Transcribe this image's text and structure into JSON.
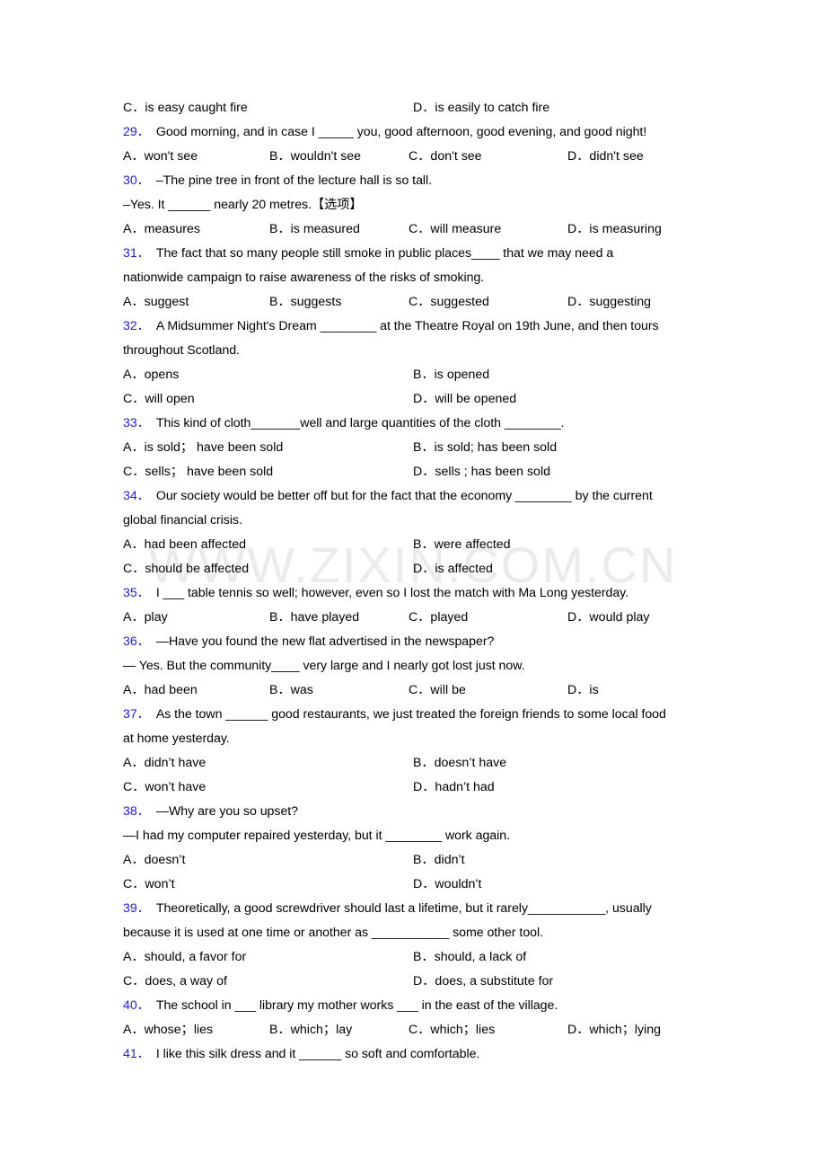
{
  "page": {
    "watermark": "WWW.ZIXIN.COM.CN",
    "accent_blue": "#2222cc",
    "background": "#ffffff",
    "text_color": "#000000"
  },
  "lines": {
    "prev_q_opt_c": "C．is easy caught fire",
    "prev_q_opt_d": "D．is easily to catch fire"
  },
  "questions": [
    {
      "number": "29．",
      "stem": "Good morning, and in case I _____ you, good afternoon, good evening, and good night!",
      "layout": "four",
      "options": [
        "A．won't see",
        "B．wouldn't see",
        "C．don't see",
        "D．didn't see"
      ]
    },
    {
      "number": "30．",
      "stem": "–The pine tree in front of the lecture hall is so tall.",
      "stem2": "–Yes. It ______ nearly 20 metres.【选项】",
      "layout": "four",
      "options": [
        "A．measures",
        "B．is measured",
        "C．will measure",
        "D．is measuring"
      ]
    },
    {
      "number": "31．",
      "stem": "The fact that so many people still smoke in public places____ that we may need a",
      "stem2": "nationwide campaign to raise awareness of the risks of smoking.",
      "layout": "four",
      "options": [
        "A．suggest",
        "B．suggests",
        "C．suggested",
        "D．suggesting"
      ]
    },
    {
      "number": "32．",
      "stem": "A Midsummer Night's Dream ________ at the Theatre Royal on 19th June, and then tours",
      "stem2": "throughout Scotland.",
      "layout": "two",
      "options": [
        "A．opens",
        "B．is opened",
        "C．will open",
        "D．will be opened"
      ]
    },
    {
      "number": "33．",
      "stem": "This kind of cloth_______well and large quantities of the cloth ________.",
      "layout": "two",
      "options": [
        "A．is sold；  have been sold",
        "B．is sold; has been sold",
        "C．sells；  have been sold",
        "D．sells ; has been sold"
      ]
    },
    {
      "number": "34．",
      "stem": "Our society would be better off but for the fact that the economy ________ by the current",
      "stem2": "global financial crisis.",
      "layout": "two",
      "options": [
        "A．had been affected",
        "B．were affected",
        "C．should be affected",
        "D．is affected"
      ]
    },
    {
      "number": "35．",
      "stem": "I ___ table tennis so well; however, even so I lost the match with Ma Long yesterday.",
      "layout": "four",
      "options": [
        "A．play",
        "B．have played",
        "C．played",
        "D．would play"
      ]
    },
    {
      "number": "36．",
      "stem": "—Have you found the new flat advertised in the newspaper?",
      "stem2": "— Yes. But the community____ very large and I nearly got lost just now.",
      "layout": "four",
      "options": [
        "A．had been",
        "B．was",
        "C．will be",
        "D．is"
      ]
    },
    {
      "number": "37．",
      "stem": "As the town ______ good restaurants, we just treated the foreign friends to some local food",
      "stem2": "at home yesterday.",
      "layout": "two",
      "options": [
        "A．didn’t have",
        "B．doesn’t have",
        "C．won’t have",
        "D．hadn’t had"
      ]
    },
    {
      "number": "38．",
      "stem": "—Why are you so upset?",
      "stem2": "—I had my computer repaired yesterday, but it ________ work again.",
      "layout": "two",
      "options": [
        "A．doesn’t",
        "B．didn’t",
        "C．won’t",
        "D．wouldn’t"
      ]
    },
    {
      "number": "39．",
      "stem": "Theoretically, a good screwdriver should last a lifetime, but it rarely___________, usually",
      "stem2": "because it is used at one time or another as ___________ some other tool.",
      "layout": "two",
      "options": [
        "A．should, a favor for",
        "B．should, a lack of",
        "C．does, a way of",
        "D．does, a substitute for"
      ]
    },
    {
      "number": "40．",
      "stem": "The school in ___ library my mother works ___ in the east of the village.",
      "layout": "four",
      "options": [
        "A．whose；lies",
        "B．which；lay",
        "C．which；lies",
        "D．which；lying"
      ]
    },
    {
      "number": "41．",
      "stem": "I like this silk dress and it ______ so soft and comfortable.",
      "layout": "none",
      "options": []
    }
  ]
}
